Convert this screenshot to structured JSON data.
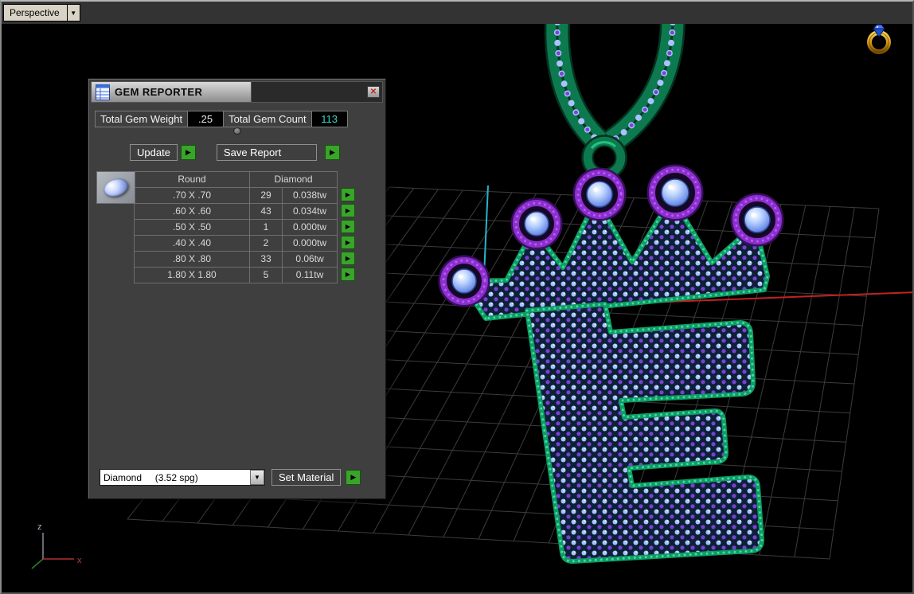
{
  "viewport": {
    "label": "Perspective",
    "dropdown_icon": "▼"
  },
  "dialog": {
    "title": "GEM REPORTER",
    "close_icon": "✕",
    "totals": {
      "weight_label": "Total Gem Weight",
      "weight_value": ".25",
      "count_label": "Total Gem Count",
      "count_value": "113"
    },
    "buttons": {
      "update": "Update",
      "save_report": "Save Report",
      "set_material": "Set Material",
      "arrow_icon": "▶"
    },
    "table": {
      "shape_header": "Round",
      "material_header": "Diamond",
      "rows": [
        {
          "size": ".70 X .70",
          "count": "29",
          "weight": "0.038tw"
        },
        {
          "size": ".60 X .60",
          "count": "43",
          "weight": "0.034tw"
        },
        {
          "size": ".50 X .50",
          "count": "1",
          "weight": "0.000tw"
        },
        {
          "size": ".40 X .40",
          "count": "2",
          "weight": "0.000tw"
        },
        {
          "size": ".80 X .80",
          "count": "33",
          "weight": "0.06tw"
        },
        {
          "size": "1.80 X 1.80",
          "count": "5",
          "weight": "0.11tw"
        }
      ]
    },
    "material_select": {
      "value": "Diamond     (3.52 spg)",
      "dropdown_icon": "▼"
    }
  },
  "axis": {
    "z": "z",
    "x": "x"
  },
  "colors": {
    "accent_green": "#3aa32b",
    "count_teal": "#3ad6c6",
    "metal_green": "#0f9c66",
    "bezel_purple": "#8d2fd0",
    "gem_blue": "#a9c2ff",
    "gem_purple": "#7b3fd4",
    "axis_red": "#c23b3b",
    "axis_cyan": "#2ab3c9"
  }
}
